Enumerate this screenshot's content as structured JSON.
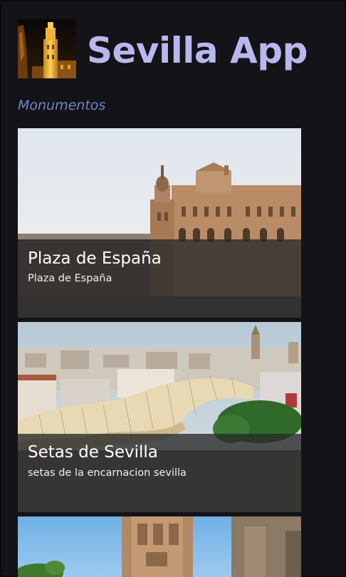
{
  "app": {
    "title": "Sevilla App",
    "logo_icon": "giralda-tower-icon"
  },
  "section": {
    "title": "Monumentos"
  },
  "monuments": [
    {
      "title": "Plaza de España",
      "subtitle": "Plaza de España",
      "image": "plaza-de-espana-photo"
    },
    {
      "title": "Setas de Sevilla",
      "subtitle": "setas de la encarnacion sevilla",
      "image": "setas-de-sevilla-photo"
    },
    {
      "title": "",
      "subtitle": "",
      "image": "giralda-photo"
    }
  ],
  "colors": {
    "background": "#141317",
    "title": "#b8b8ee",
    "section": "#6f86c8",
    "overlay": "#282828"
  }
}
